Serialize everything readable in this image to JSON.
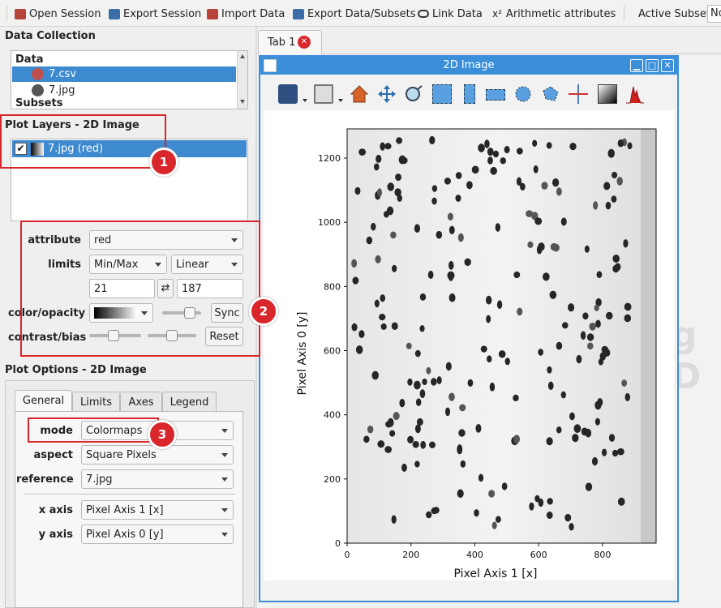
{
  "toolbar": {
    "open_session": "Open Session",
    "export_session": "Export Session",
    "import_data": "Import Data",
    "export_data": "Export Data/Subsets",
    "link_data": "Link Data",
    "arith_icon": "x²",
    "arithmetic": "Arithmetic attributes",
    "active_subset_label": "Active Subset:",
    "active_subset_value": "No"
  },
  "data_collection": {
    "title": "Data Collection",
    "group_data": "Data",
    "items": [
      {
        "label": "7.csv",
        "color": "#c0504d"
      },
      {
        "label": "7.jpg",
        "color": "#555555"
      }
    ],
    "group_subsets": "Subsets"
  },
  "plot_layers": {
    "title": "Plot Layers - 2D Image",
    "layer_label": "7.jpg (red)",
    "checked": "✔"
  },
  "layer_options": {
    "attribute_label": "attribute",
    "attribute_value": "red",
    "limits_label": "limits",
    "limits_mode": "Min/Max",
    "limits_scale": "Linear",
    "limit_low": "21",
    "limit_high": "187",
    "swap_icon": "⇄",
    "color_label": "color/opacity",
    "sync_button": "Sync",
    "contrast_label": "contrast/bias",
    "reset_button": "Reset"
  },
  "plot_options": {
    "title": "Plot Options - 2D Image",
    "tabs": [
      "General",
      "Limits",
      "Axes",
      "Legend"
    ],
    "mode_label": "mode",
    "mode_value": "Colormaps",
    "aspect_label": "aspect",
    "aspect_value": "Square Pixels",
    "reference_label": "reference",
    "reference_value": "7.jpg",
    "xaxis_label": "x axis",
    "xaxis_value": "Pixel Axis 1 [x]",
    "yaxis_label": "y axis",
    "yaxis_value": "Pixel Axis 0 [y]"
  },
  "annotations": [
    "1",
    "2",
    "3"
  ],
  "workspace": {
    "tab_label": "Tab 1",
    "tab_close": "✕",
    "bg_text": "g D"
  },
  "viewer": {
    "title": "2D Image",
    "btn_min": "▁",
    "btn_max": "□",
    "btn_close": "✕",
    "xlabel": "Pixel Axis 1 [x]",
    "ylabel": "Pixel Axis 0 [y]",
    "xticks": [
      "0",
      "200",
      "400",
      "600",
      "800"
    ],
    "yticks": [
      "0",
      "200",
      "400",
      "600",
      "800",
      "1000",
      "1200"
    ]
  }
}
